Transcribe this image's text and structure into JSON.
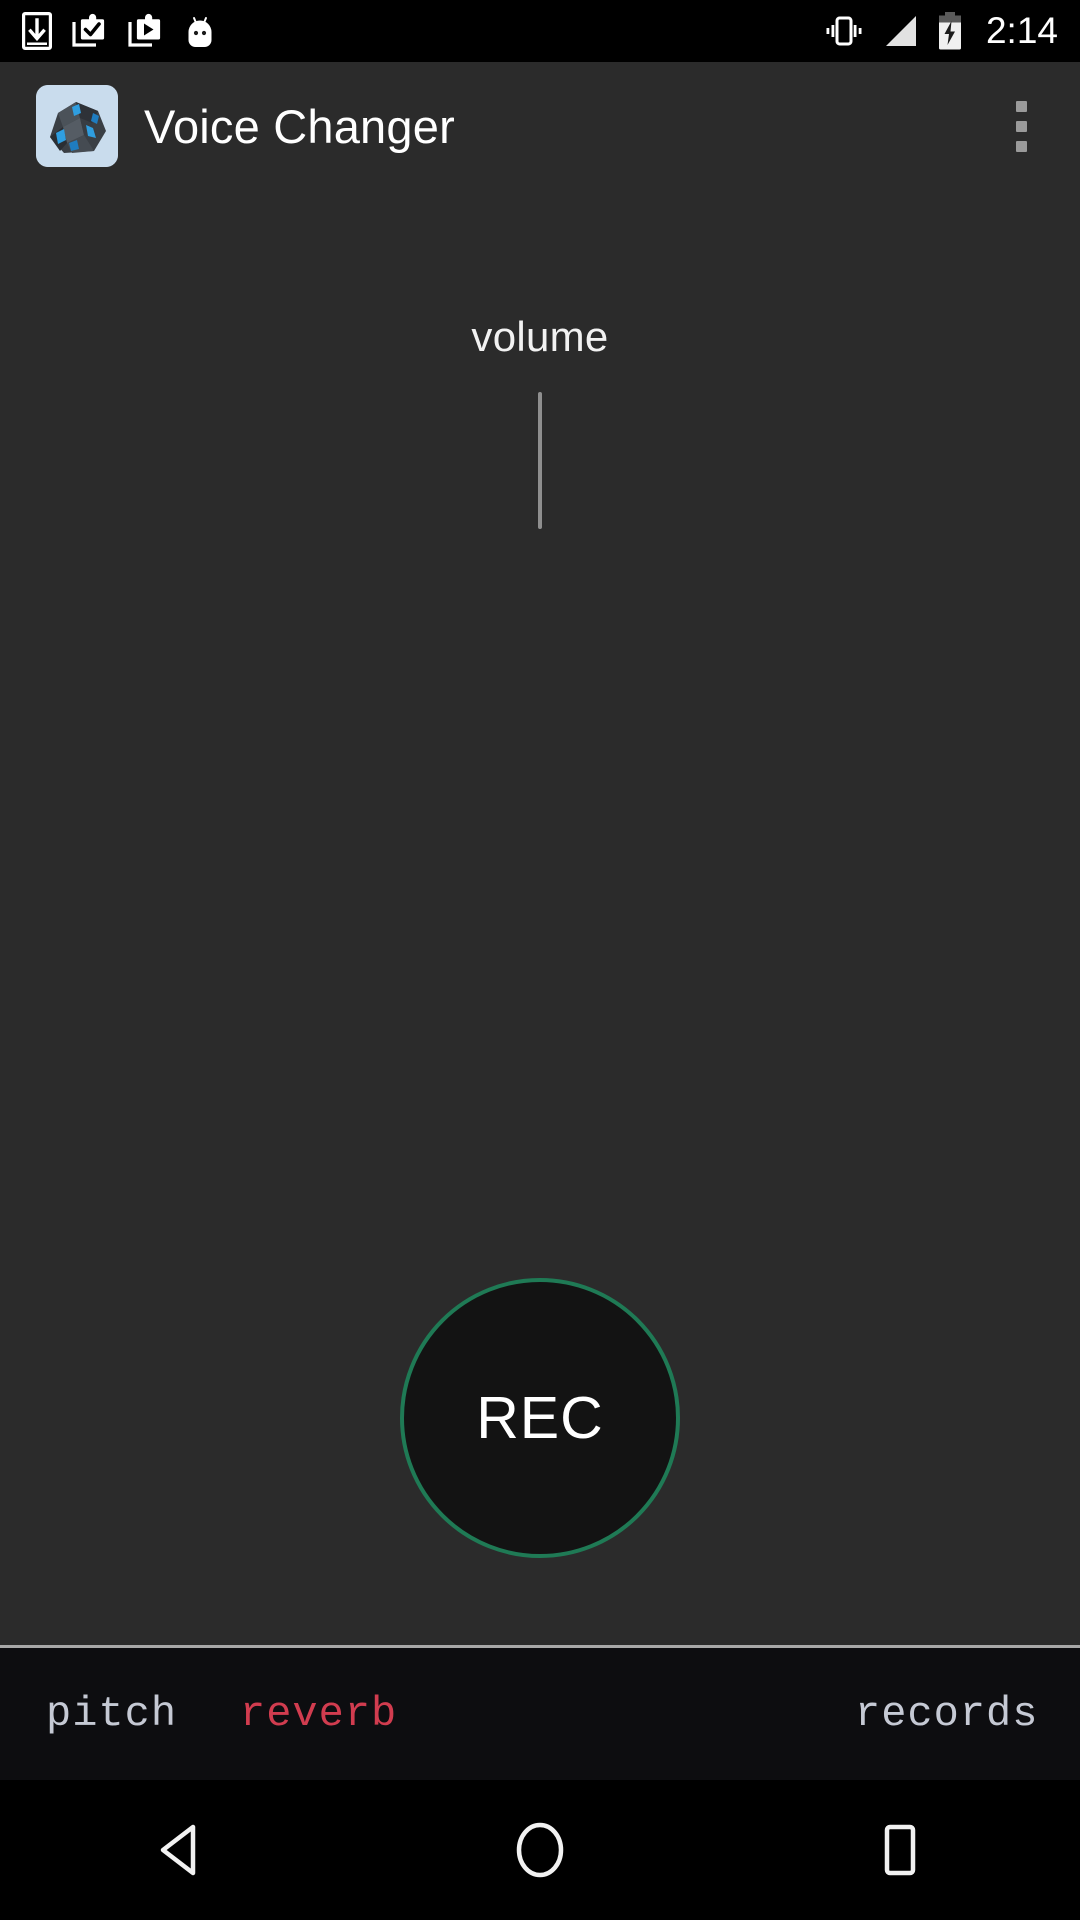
{
  "status_bar": {
    "icons_left": [
      "download-icon",
      "app-installed-icon",
      "app-play-icon",
      "android-mascot-icon"
    ],
    "icons_right": [
      "vibrate-icon",
      "signal-strength-icon",
      "battery-charging-icon"
    ],
    "time": "2:14"
  },
  "action_bar": {
    "app_icon": "voice-changer-app-icon",
    "title": "Voice Changer",
    "overflow_menu": "overflow-menu-icon"
  },
  "content": {
    "volume_label": "volume",
    "volume_slider_name": "volume-slider",
    "rec_button_label": "REC"
  },
  "tabs": [
    {
      "id": "pitch",
      "label": "pitch",
      "color": "#c5c9d4",
      "selected": false
    },
    {
      "id": "reverb",
      "label": "reverb",
      "color": "#d13c4f",
      "selected": true
    },
    {
      "id": "records",
      "label": "records",
      "color": "#c5c9d4",
      "selected": false
    }
  ],
  "nav_bar": {
    "back": "back-icon",
    "home": "home-icon",
    "recents": "recents-icon"
  },
  "colors": {
    "background": "#2b2b2b",
    "status_bar": "#000000",
    "tab_bar": "#0d0d10",
    "rec_border": "#1f7a55",
    "rec_fill": "#131313",
    "accent_red": "#d13c4f",
    "tab_text": "#c5c9d4"
  }
}
